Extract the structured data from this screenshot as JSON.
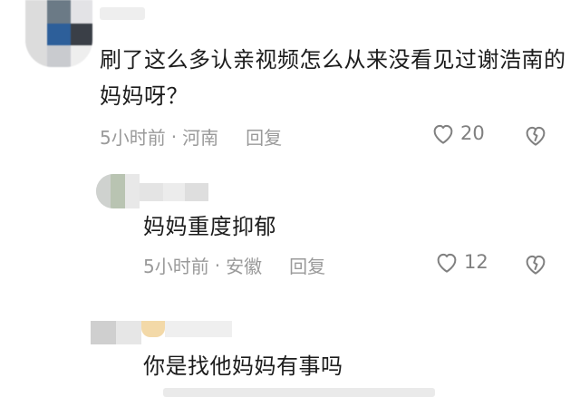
{
  "comments": [
    {
      "text": "刷了这么多认亲视频怎么从来没看见过谢浩南的妈妈呀？",
      "time": "5小时前",
      "location": "河南",
      "reply_label": "回复",
      "likes": "20"
    },
    {
      "text": "妈妈重度抑郁",
      "time": "5小时前",
      "location": "安徽",
      "reply_label": "回复",
      "likes": "12"
    },
    {
      "text": "你是找他妈妈有事吗"
    }
  ],
  "separator": "·",
  "icons": {
    "like": "heart-outline-icon",
    "dislike": "broken-heart-icon"
  },
  "colors": {
    "text": "#1c1c1c",
    "meta": "#9a9a9a",
    "icon": "#808080"
  }
}
